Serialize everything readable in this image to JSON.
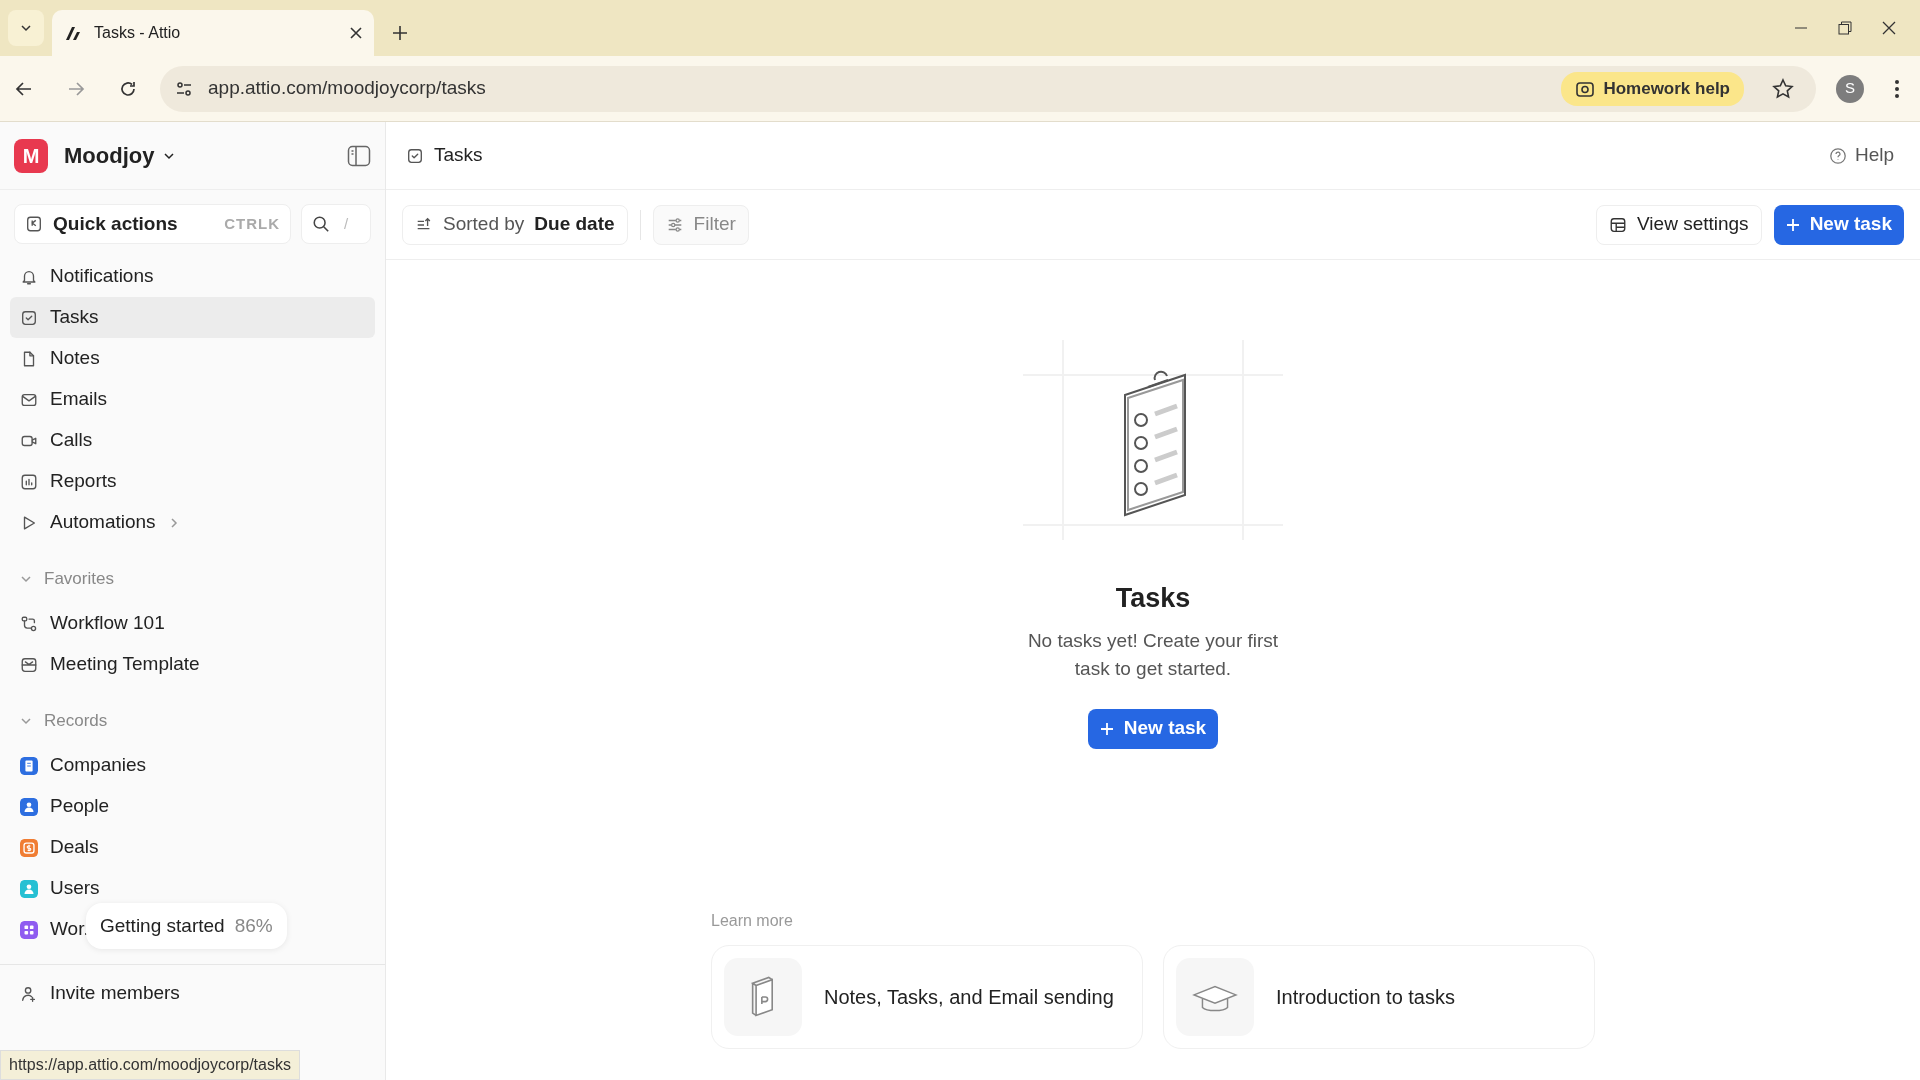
{
  "browser": {
    "tab_title": "Tasks - Attio",
    "url": "app.attio.com/moodjoycorp/tasks",
    "homework_help": "Homework help",
    "profile_initial": "S"
  },
  "workspace": {
    "initial": "M",
    "name": "Moodjoy"
  },
  "quick_actions": {
    "label": "Quick actions",
    "shortcut": "CTRLK",
    "search_shortcut": "/"
  },
  "nav": [
    {
      "label": "Notifications",
      "kind": "bell",
      "selected": false,
      "expandable": false
    },
    {
      "label": "Tasks",
      "kind": "check",
      "selected": true,
      "expandable": false
    },
    {
      "label": "Notes",
      "kind": "file",
      "selected": false,
      "expandable": false
    },
    {
      "label": "Emails",
      "kind": "mail",
      "selected": false,
      "expandable": false
    },
    {
      "label": "Calls",
      "kind": "video",
      "selected": false,
      "expandable": false
    },
    {
      "label": "Reports",
      "kind": "chart",
      "selected": false,
      "expandable": false
    },
    {
      "label": "Automations",
      "kind": "play",
      "selected": false,
      "expandable": true
    }
  ],
  "favorites": {
    "title": "Favorites",
    "expanded": true,
    "items": [
      {
        "label": "Workflow 101",
        "kind": "workflow"
      },
      {
        "label": "Meeting Template",
        "kind": "template"
      }
    ]
  },
  "records": {
    "title": "Records",
    "expanded": true,
    "items": [
      {
        "label": "Companies",
        "kind": "building",
        "color": "#2d6ee0"
      },
      {
        "label": "People",
        "kind": "person",
        "color": "#2d6ee0"
      },
      {
        "label": "Deals",
        "kind": "dollar",
        "color": "#f07d33"
      },
      {
        "label": "Users",
        "kind": "person",
        "color": "#26c0d3"
      },
      {
        "label": "Wor.",
        "kind": "grid",
        "color": "#8f5cf0"
      }
    ]
  },
  "getting_started": {
    "label": "Getting started",
    "percent": "86%"
  },
  "invite": "Invite members",
  "page": {
    "title": "Tasks",
    "help": "Help"
  },
  "toolbar": {
    "sort_prefix": "Sorted by",
    "sort_value": "Due date",
    "filter": "Filter",
    "view_settings": "View settings",
    "new_task": "New task"
  },
  "empty": {
    "title": "Tasks",
    "message": "No tasks yet! Create your first task to get started.",
    "button": "New task"
  },
  "learn_more": {
    "title": "Learn more",
    "cards": [
      {
        "label": "Notes, Tasks, and Email sending",
        "kind": "book"
      },
      {
        "label": "Introduction to tasks",
        "kind": "cap"
      }
    ]
  },
  "status_url": "https://app.attio.com/moodjoycorp/tasks"
}
